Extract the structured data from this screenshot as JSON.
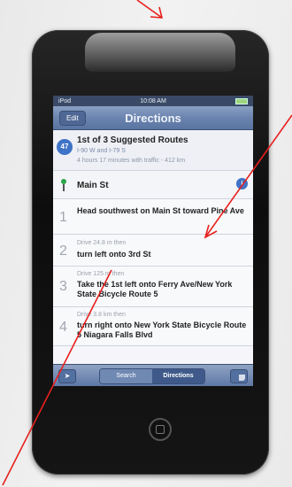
{
  "status_bar": {
    "carrier": "iPod",
    "time": "10:08 AM"
  },
  "navbar": {
    "edit_label": "Edit",
    "title": "Directions"
  },
  "route_summary": {
    "icon_label": "47",
    "title": "1st of 3 Suggested Routes",
    "via": "I-90 W and I-79 S",
    "time": "4 hours 17 minutes with traffic - 412 km"
  },
  "start": {
    "label": "Main St",
    "info_icon": "info-icon"
  },
  "steps": [
    {
      "num": "1",
      "distance": "",
      "text": "Head southwest on Main St toward Pine Ave"
    },
    {
      "num": "2",
      "distance": "Drive 24.8 m then",
      "text": "turn left onto 3rd St"
    },
    {
      "num": "3",
      "distance": "Drive 125 m then",
      "text": "Take the 1st left onto Ferry Ave/New York State Bicycle Route 5"
    },
    {
      "num": "4",
      "distance": "Drive 3.8 km then",
      "text": "turn right onto New York State Bicycle Route 5 Niagara Falls Blvd"
    }
  ],
  "toolbar": {
    "search_label": "Search",
    "directions_label": "Directions",
    "location_icon": "location-arrow-icon",
    "curl_icon": "page-curl-icon"
  },
  "colors": {
    "annotation": "#e8201e",
    "navbar": "#6b84af",
    "route_icon": "#3f73c6"
  }
}
